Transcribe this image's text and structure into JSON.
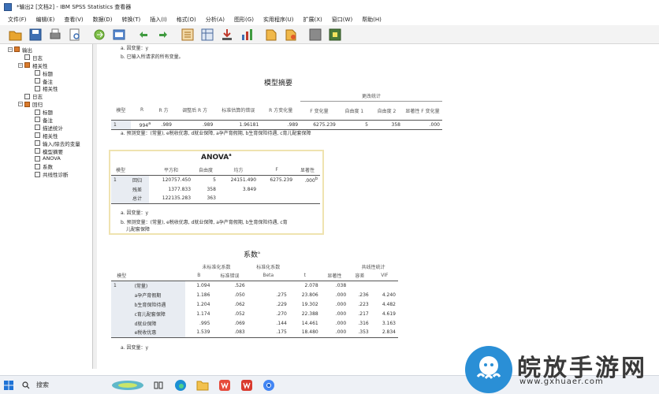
{
  "window": {
    "title": "*输出2 [文档2] - IBM SPSS Statistics 查看器"
  },
  "menu": [
    "文件(F)",
    "编辑(E)",
    "查看(V)",
    "数据(D)",
    "转换(T)",
    "插入(I)",
    "格式(O)",
    "分析(A)",
    "图形(G)",
    "实用程序(U)",
    "扩展(X)",
    "窗口(W)",
    "帮助(H)"
  ],
  "toolbar_icons": [
    "open-icon",
    "save-icon",
    "print-icon",
    "print-preview-icon",
    "export-icon",
    "recall-dialog-icon",
    "undo-icon",
    "redo-icon",
    "goto-data-icon",
    "goto-case-icon",
    "goto-variable-icon",
    "variables-icon",
    "insert-output-icon",
    "insert-title-icon",
    "hide-icon",
    "show-icon"
  ],
  "outline": [
    {
      "label": "输出",
      "level": 0,
      "toggle": "−",
      "icon": "book"
    },
    {
      "label": "日志",
      "level": 1,
      "toggle": "",
      "icon": "page"
    },
    {
      "label": "相关性",
      "level": 1,
      "toggle": "−",
      "icon": "book"
    },
    {
      "label": "标题",
      "level": 2,
      "toggle": "",
      "icon": "page"
    },
    {
      "label": "备注",
      "level": 2,
      "toggle": "",
      "icon": "page"
    },
    {
      "label": "相关性",
      "level": 2,
      "toggle": "",
      "icon": "page"
    },
    {
      "label": "日志",
      "level": 1,
      "toggle": "",
      "icon": "page"
    },
    {
      "label": "回归",
      "level": 1,
      "toggle": "−",
      "icon": "book"
    },
    {
      "label": "标题",
      "level": 2,
      "toggle": "",
      "icon": "page"
    },
    {
      "label": "备注",
      "level": 2,
      "toggle": "",
      "icon": "page"
    },
    {
      "label": "描述统计",
      "level": 2,
      "toggle": "",
      "icon": "page"
    },
    {
      "label": "相关性",
      "level": 2,
      "toggle": "",
      "icon": "page"
    },
    {
      "label": "输入/除去的变量",
      "level": 2,
      "toggle": "",
      "icon": "page"
    },
    {
      "label": "模型摘要",
      "level": 2,
      "toggle": "",
      "icon": "page"
    },
    {
      "label": "ANOVA",
      "level": 2,
      "toggle": "",
      "icon": "page"
    },
    {
      "label": "系数",
      "level": 2,
      "toggle": "",
      "icon": "page"
    },
    {
      "label": "共线性诊断",
      "level": 2,
      "toggle": "",
      "icon": "page"
    }
  ],
  "notes_top": [
    "a. 因变量：y",
    "b. 已输入所请求的所有变量。"
  ],
  "model_summary": {
    "title": "模型摘要",
    "group_header": "更改统计",
    "headers": [
      "模型",
      "R",
      "R 方",
      "调整后 R 方",
      "标准估算的错误",
      "R 方变化量",
      "F 变化量",
      "自由度 1",
      "自由度 2",
      "显著性 F 变化量"
    ],
    "row": {
      "model": "1",
      "r": "994",
      "r_sup": "a",
      "r2": ".989",
      "adj_r2": ".989",
      "se": "1.96181",
      "r2_change": ".989",
      "f_change": "6275.239",
      "df1": "5",
      "df2": "358",
      "sig": ".000"
    },
    "note": "a. 预测变量：(常量), e税收优惠, d就业保障, a孕产育假期, b生育保险待遇, c育儿配套保障"
  },
  "anova": {
    "title": "ANOVA",
    "title_sup": "a",
    "headers": [
      "模型",
      "",
      "平方和",
      "自由度",
      "均方",
      "F",
      "显著性"
    ],
    "rows": [
      {
        "model": "1",
        "label": "回归",
        "ss": "120757.450",
        "df": "5",
        "ms": "24151.490",
        "f": "6275.239",
        "sig": ".000",
        "sig_sup": "b"
      },
      {
        "model": "",
        "label": "残差",
        "ss": "1377.833",
        "df": "358",
        "ms": "3.849",
        "f": "",
        "sig": "",
        "sig_sup": ""
      },
      {
        "model": "",
        "label": "总计",
        "ss": "122135.283",
        "df": "363",
        "ms": "",
        "f": "",
        "sig": "",
        "sig_sup": ""
      }
    ],
    "note_a": "a. 因变量：y",
    "note_b_line1": "b. 预测变量：(常量), e税收优惠, d就业保障, a孕产育假期, b生育保险待遇, c育",
    "note_b_line2": "儿配套保障"
  },
  "coefficients": {
    "title": "系数",
    "title_sup": "a",
    "group_headers": [
      "未标准化系数",
      "标准化系数",
      "共线性统计"
    ],
    "headers": [
      "模型",
      "",
      "B",
      "标准错误",
      "Beta",
      "t",
      "显著性",
      "容差",
      "VIF"
    ],
    "rows": [
      {
        "model": "1",
        "label": "(常量)",
        "b": "1.094",
        "se": ".526",
        "beta": "",
        "t": "2.078",
        "sig": ".038",
        "tol": "",
        "vif": ""
      },
      {
        "model": "",
        "label": "a孕产育假期",
        "b": "1.186",
        "se": ".050",
        "beta": ".275",
        "t": "23.806",
        "sig": ".000",
        "tol": ".236",
        "vif": "4.240"
      },
      {
        "model": "",
        "label": "b生育保险待遇",
        "b": "1.204",
        "se": ".062",
        "beta": ".229",
        "t": "19.302",
        "sig": ".000",
        "tol": ".223",
        "vif": "4.482"
      },
      {
        "model": "",
        "label": "c育儿配套保障",
        "b": "1.174",
        "se": ".052",
        "beta": ".270",
        "t": "22.388",
        "sig": ".000",
        "tol": ".217",
        "vif": "4.619"
      },
      {
        "model": "",
        "label": "d就业保障",
        "b": ".995",
        "se": ".069",
        "beta": ".144",
        "t": "14.461",
        "sig": ".000",
        "tol": ".316",
        "vif": "3.163"
      },
      {
        "model": "",
        "label": "e税收优惠",
        "b": "1.539",
        "se": ".083",
        "beta": ".175",
        "t": "18.480",
        "sig": ".000",
        "tol": ".353",
        "vif": "2.834"
      }
    ],
    "note": "a. 因变量：y"
  },
  "taskbar": {
    "search_label": "搜索",
    "icons": [
      "windows-start-icon",
      "search-icon",
      "widget-icon",
      "task-view-icon",
      "edge-browser-icon",
      "file-explorer-icon",
      "wps-icon",
      "wps-writer-icon",
      "chrome-icon"
    ]
  },
  "watermark": {
    "text": "皖放手游网",
    "url": "www.gxhuaer.com"
  }
}
